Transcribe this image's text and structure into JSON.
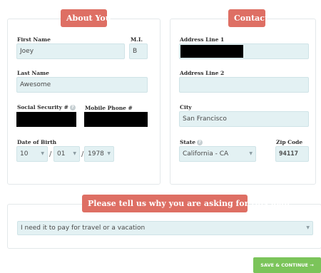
{
  "about": {
    "title": "About You",
    "first_name_label": "First Name",
    "first_name_value": "Joey",
    "mi_label": "M.I.",
    "mi_value": "B",
    "last_name_label": "Last Name",
    "last_name_value": "Awesome",
    "ssn_label": "Social Security #",
    "mobile_label": "Mobile Phone #",
    "dob_label": "Date of Birth",
    "dob_month": "10",
    "dob_day": "01",
    "dob_year": "1978",
    "dob_separator": "/"
  },
  "contact": {
    "title": "Contact",
    "address1_label": "Address Line 1",
    "address2_label": "Address Line 2",
    "address2_value": "",
    "city_label": "City",
    "city_value": "San Francisco",
    "state_label": "State",
    "state_value": "California - CA",
    "zip_label": "Zip Code",
    "zip_value": "94117"
  },
  "reason": {
    "title": "Please tell us why you are asking for this loan:",
    "selected": "I need it to pay for travel or a vacation"
  },
  "actions": {
    "continue_label": "SAVE & CONTINUE →"
  },
  "icons": {
    "dropdown": "▼",
    "info": "?"
  },
  "colors": {
    "accent_red": "#de6f64",
    "field_bg": "#e3f1f3",
    "continue_green": "#7bc45a"
  }
}
